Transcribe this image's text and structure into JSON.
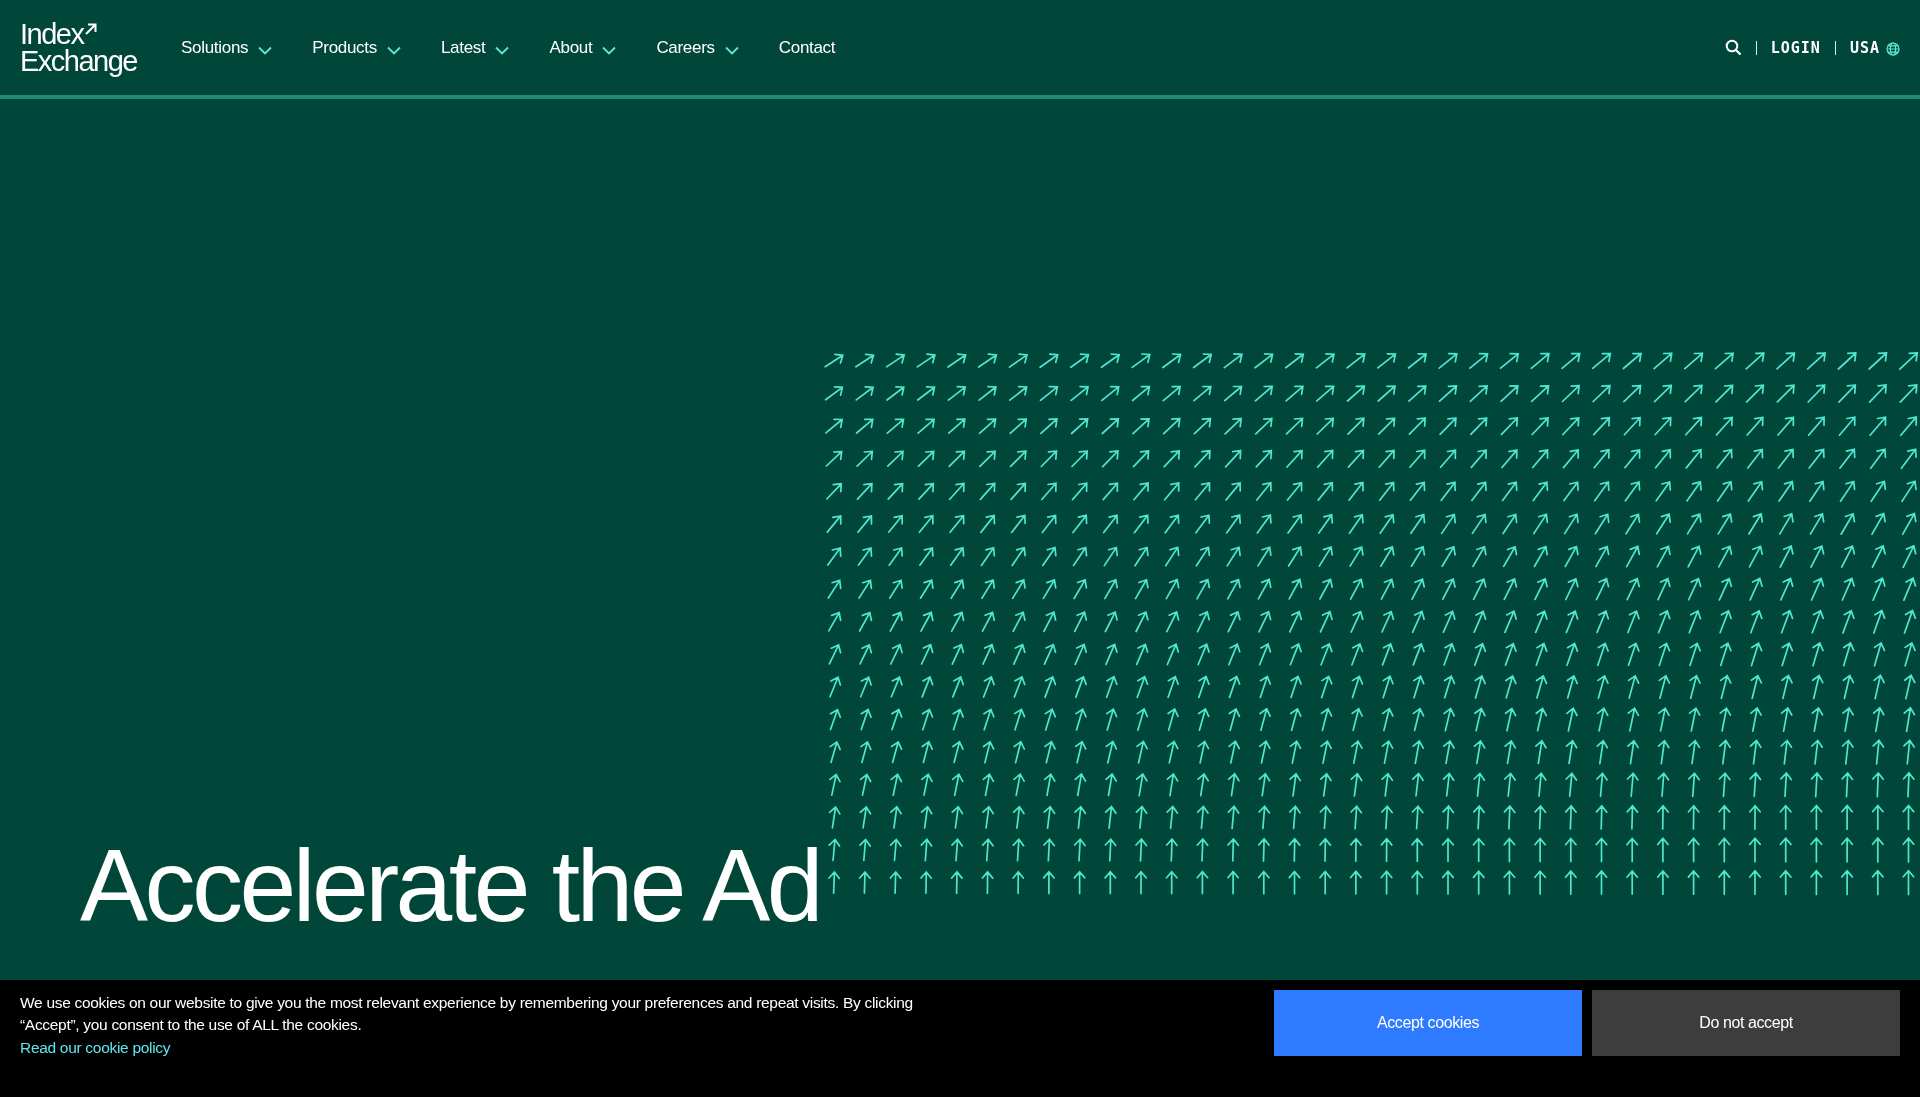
{
  "logo": {
    "line_1": "Index",
    "line_2": "Exchange"
  },
  "nav": [
    {
      "label": "Solutions",
      "has_menu": true
    },
    {
      "label": "Products",
      "has_menu": true
    },
    {
      "label": "Latest",
      "has_menu": true
    },
    {
      "label": "About",
      "has_menu": true
    },
    {
      "label": "Careers",
      "has_menu": true
    },
    {
      "label": "Contact",
      "has_menu": false
    }
  ],
  "header_tools": {
    "login": "LOGIN",
    "region": "USA"
  },
  "hero": {
    "headline": "Accelerate the Ad"
  },
  "cookie_banner": {
    "message": "We use cookies on our website to give you the most relevant experience by remembering your preferences and repeat visits. By clicking “Accept”, you consent to the use of ALL the cookies.",
    "link": "Read our cookie policy",
    "buttons": [
      {
        "label": "Accept cookies",
        "kind": "primary"
      },
      {
        "label": "Do not accept",
        "kind": "secondary"
      }
    ]
  }
}
